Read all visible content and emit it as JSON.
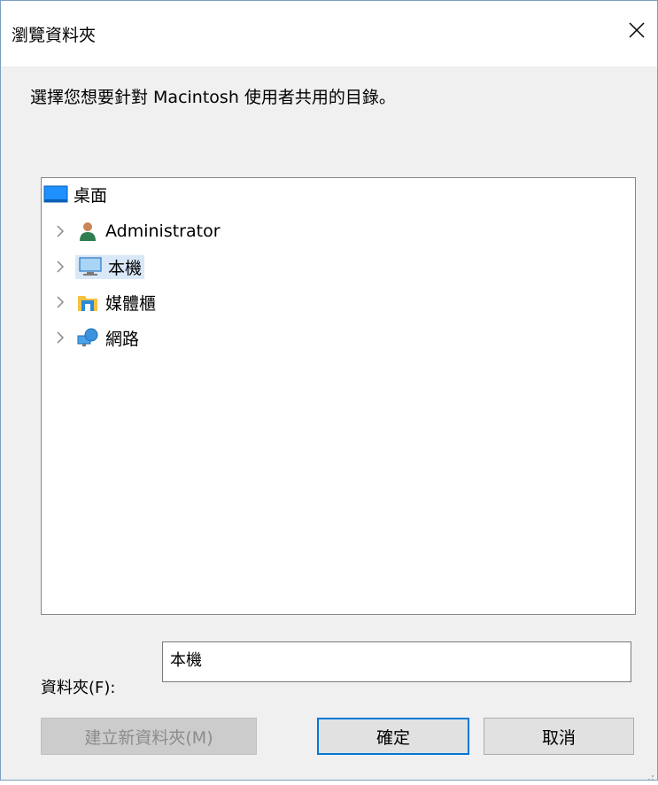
{
  "window": {
    "title": "瀏覽資料夾"
  },
  "instruction": "選擇您想要針對 Macintosh 使用者共用的目錄。",
  "tree": {
    "items": [
      {
        "label": "桌面",
        "icon": "desktop-icon",
        "has_chevron": false,
        "selected": false
      },
      {
        "label": "Administrator",
        "icon": "user-icon",
        "has_chevron": true,
        "selected": false
      },
      {
        "label": "本機",
        "icon": "computer-icon",
        "has_chevron": true,
        "selected": true
      },
      {
        "label": "媒體櫃",
        "icon": "library-icon",
        "has_chevron": true,
        "selected": false
      },
      {
        "label": "網路",
        "icon": "network-icon",
        "has_chevron": true,
        "selected": false
      }
    ]
  },
  "folder_field": {
    "label": "資料夾(F):",
    "value": "本機"
  },
  "buttons": {
    "new_folder": "建立新資料夾(M)",
    "ok": "確定",
    "cancel": "取消"
  },
  "colors": {
    "accent": "#0078d7",
    "selection": "#d9e8f8",
    "dialog_bg": "#f0f0f0"
  }
}
